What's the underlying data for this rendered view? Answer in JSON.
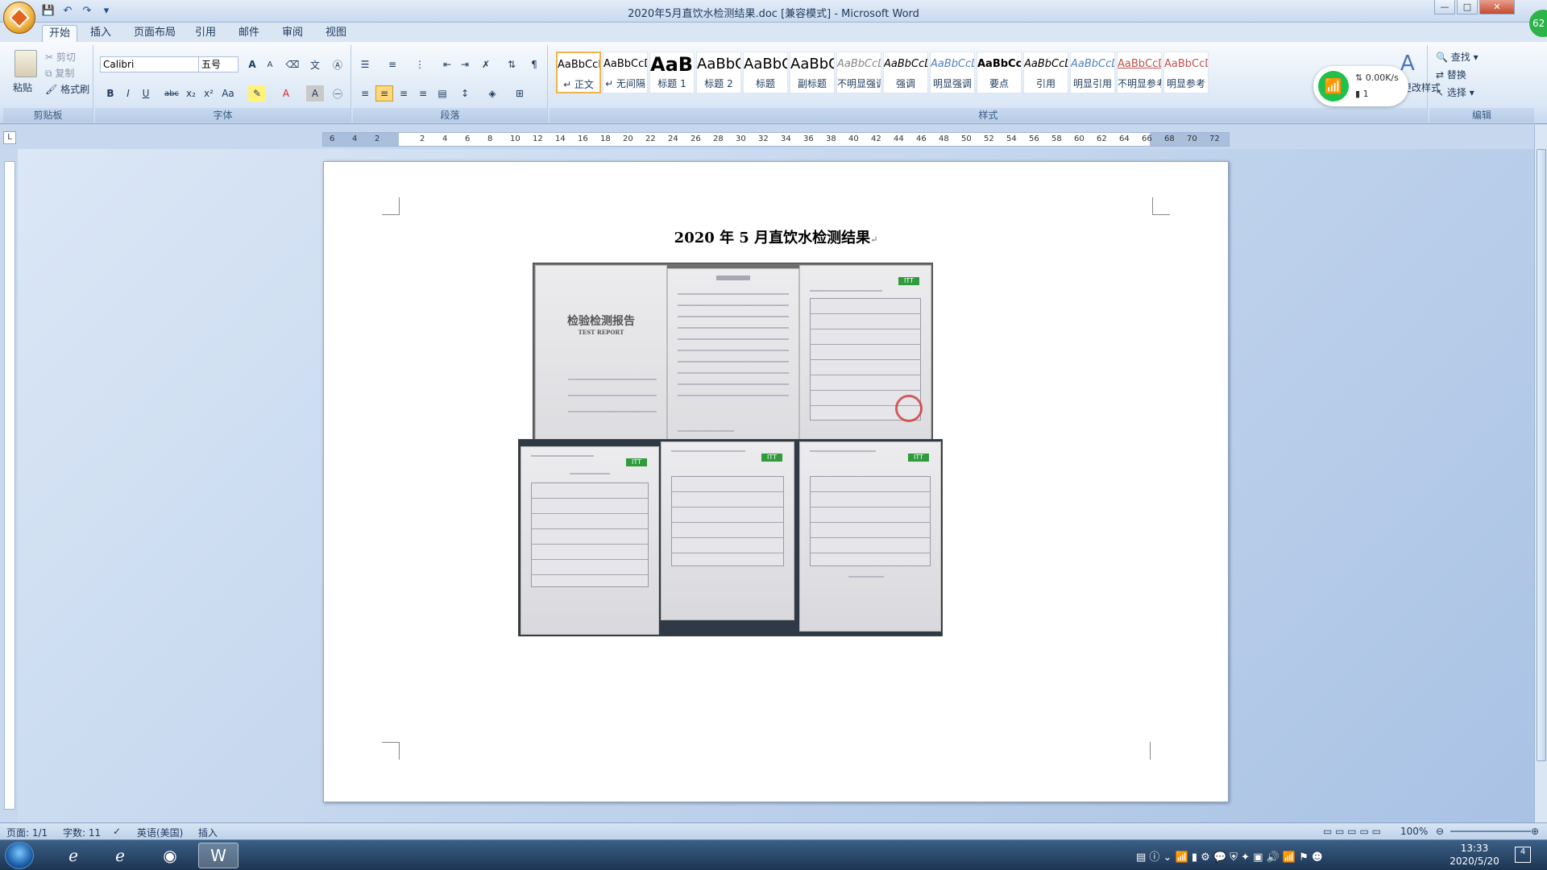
{
  "window": {
    "title": "2020年5月直饮水检测结果.doc [兼容模式] - Microsoft Word"
  },
  "tabs": [
    "开始",
    "插入",
    "页面布局",
    "引用",
    "邮件",
    "审阅",
    "视图"
  ],
  "clipboard": {
    "paste": "粘贴",
    "cut": "剪切",
    "copy": "复制",
    "format_painter": "格式刷",
    "label": "剪贴板"
  },
  "font": {
    "name": "Calibri",
    "size": "五号",
    "label": "字体",
    "bold": "B",
    "italic": "I",
    "underline": "U",
    "strike": "abc",
    "sub": "x₂",
    "sup": "x²",
    "case": "Aa",
    "grow": "A",
    "shrink": "A"
  },
  "paragraph": {
    "label": "段落"
  },
  "styles": {
    "label": "样式",
    "change": "更改样式",
    "items": [
      {
        "sample": "AaBbCcDd",
        "name": "↵ 正文"
      },
      {
        "sample": "AaBbCcDd",
        "name": "↵ 无间隔"
      },
      {
        "sample": "AaBb",
        "name": "标题 1"
      },
      {
        "sample": "AaBbC",
        "name": "标题 2"
      },
      {
        "sample": "AaBbC",
        "name": "标题"
      },
      {
        "sample": "AaBbC",
        "name": "副标题"
      },
      {
        "sample": "AaBbCcDd",
        "name": "不明显强调"
      },
      {
        "sample": "AaBbCcDd",
        "name": "强调"
      },
      {
        "sample": "AaBbCcDd",
        "name": "明显强调"
      },
      {
        "sample": "AaBbCcDd",
        "name": "要点"
      },
      {
        "sample": "AaBbCcDd",
        "name": "引用"
      },
      {
        "sample": "AaBbCcDd",
        "name": "明显引用"
      },
      {
        "sample": "AaBbCcDd",
        "name": "不明显参考"
      },
      {
        "sample": "AaBbCcDd",
        "name": "明显参考"
      }
    ]
  },
  "editing": {
    "find": "查找",
    "replace": "替换",
    "select": "选择",
    "label": "编辑"
  },
  "network_widget": {
    "speed": "0.00K/s",
    "count": "1"
  },
  "badge": "62",
  "ruler_numbers": [
    "6",
    "4",
    "2",
    "",
    "2",
    "4",
    "6",
    "8",
    "10",
    "12",
    "14",
    "16",
    "18",
    "20",
    "22",
    "24",
    "26",
    "28",
    "30",
    "32",
    "34",
    "36",
    "38",
    "40",
    "42",
    "44",
    "46",
    "48",
    "50",
    "52",
    "54",
    "56",
    "58",
    "60",
    "62",
    "64",
    "66",
    "68",
    "70",
    "72"
  ],
  "document": {
    "title": "2020 年 5 月直饮水检测结果",
    "paragraph_mark": "↵",
    "photo_text": {
      "report_cn": "检验检测报告",
      "report_en": "TEST REPORT"
    }
  },
  "status_bar": {
    "page": "页面: 1/1",
    "words": "字数: 11",
    "language": "英语(美国)",
    "mode": "插入",
    "zoom": "100%"
  },
  "taskbar": {
    "time": "13:33",
    "date": "2020/5/20",
    "notif": "4"
  }
}
